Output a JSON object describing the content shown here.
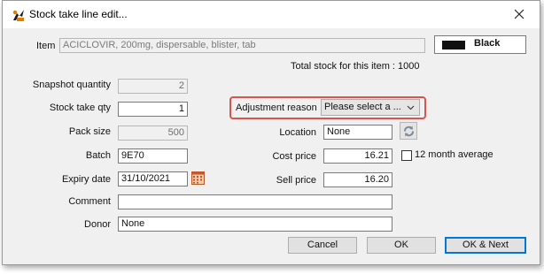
{
  "window": {
    "title": "Stock take line edit..."
  },
  "colors": {
    "highlight": "#d9534f",
    "swatch": "#111111",
    "default_button_border": "#0078d7"
  },
  "item": {
    "label": "Item",
    "value": "ACICLOVIR, 200mg, dispersable, blister, tab"
  },
  "color_selector": {
    "label": "Black"
  },
  "total_stock": "Total stock for this item : 1000",
  "snapshot_quantity": {
    "label": "Snapshot quantity",
    "value": "2"
  },
  "stock_take_qty": {
    "label": "Stock take qty",
    "value": "1"
  },
  "pack_size": {
    "label": "Pack size",
    "value": "500"
  },
  "batch": {
    "label": "Batch",
    "value": "9E70"
  },
  "expiry_date": {
    "label": "Expiry date",
    "value": "31/10/2021"
  },
  "comment": {
    "label": "Comment",
    "value": ""
  },
  "donor": {
    "label": "Donor",
    "value": "None"
  },
  "adjustment_reason": {
    "label": "Adjustment reason",
    "value": "Please select a ..."
  },
  "location": {
    "label": "Location",
    "value": "None"
  },
  "cost_price": {
    "label": "Cost price",
    "value": "16.21"
  },
  "sell_price": {
    "label": "Sell price",
    "value": "16.20"
  },
  "twelve_month_average": {
    "label": "12 month average",
    "checked": false
  },
  "buttons": {
    "cancel": "Cancel",
    "ok": "OK",
    "ok_next": "OK & Next"
  }
}
